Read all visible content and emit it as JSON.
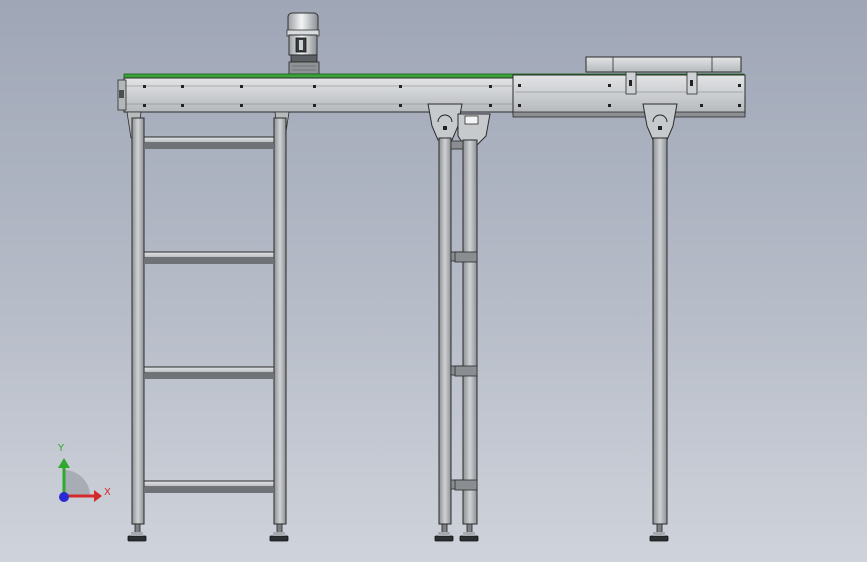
{
  "viewport": {
    "background_top": "#9fa6b6",
    "background_bottom": "#cfd3db"
  },
  "model": {
    "name": "",
    "belt_color": "#3aa33a",
    "frame_color": "#c9cccf",
    "edge_color": "#2b2b2b"
  },
  "triad": {
    "x_label": "X",
    "y_label": "Y",
    "x_color": "#d42a2a",
    "y_color": "#2ea82e",
    "z_color": "#2a2ad4"
  }
}
